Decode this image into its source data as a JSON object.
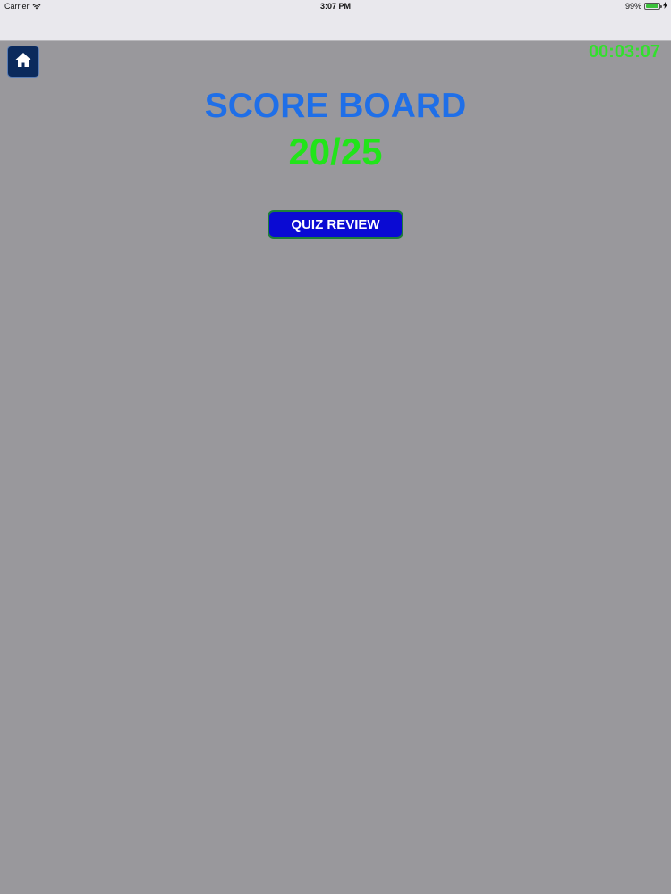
{
  "status_bar": {
    "carrier": "Carrier",
    "time": "3:07 PM",
    "battery_percent": "99%",
    "battery_level": 0.99,
    "wifi_icon": "wifi-icon",
    "charge_icon": "charging-bolt-icon"
  },
  "header": {
    "home_icon": "home-icon",
    "timer": "00:03:07"
  },
  "main": {
    "title": "SCORE BOARD",
    "score": "20/25",
    "review_button_label": "QUIZ REVIEW"
  },
  "colors": {
    "background": "#99989c",
    "title": "#1f6fe8",
    "score": "#21e41a",
    "timer": "#32e02d",
    "button": "#0a0ad3",
    "home_button": "#0b2a5c"
  }
}
